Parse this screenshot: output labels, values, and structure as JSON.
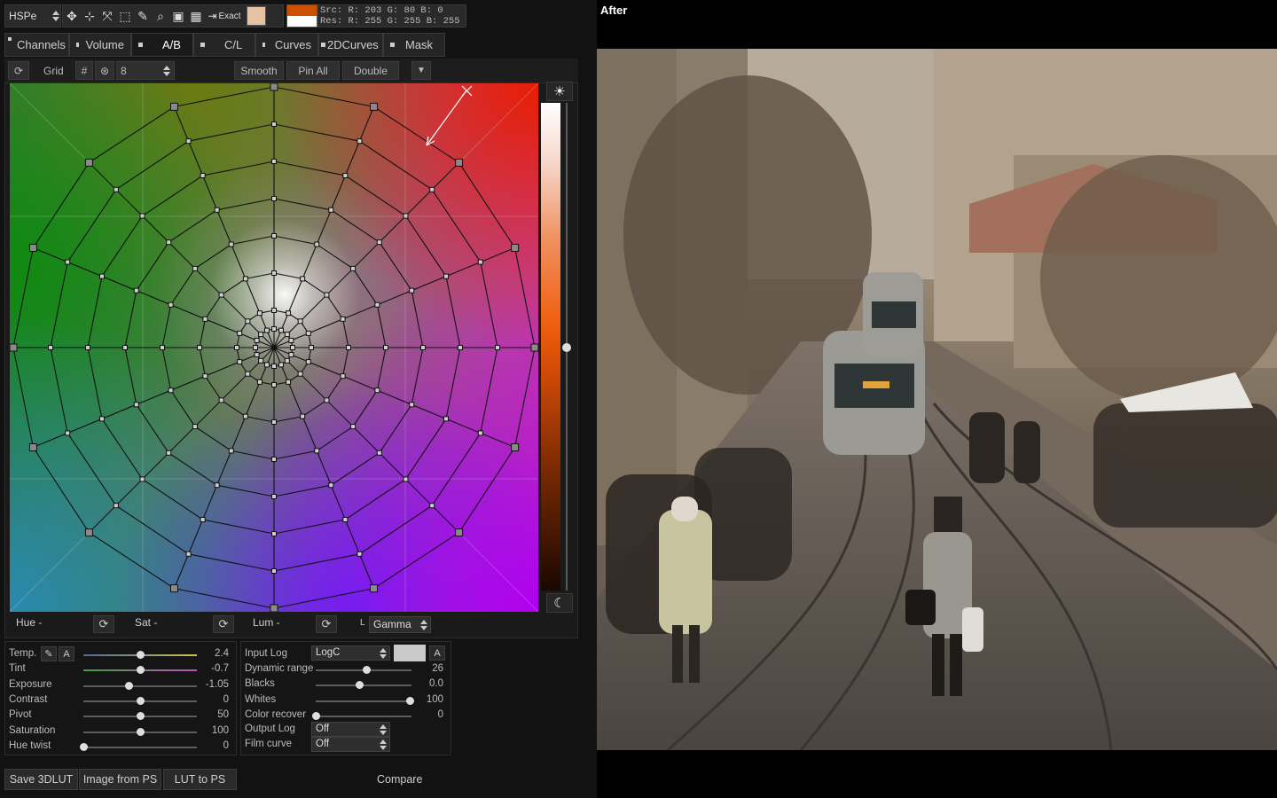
{
  "toolbar": {
    "mode_select": "HSPe",
    "exact_label": "Exact",
    "src_line": "Src: R: 203  G:  80  B:   0",
    "res_line": "Res: R: 255  G: 255  B: 255",
    "swatch_color": "#e5c2a3"
  },
  "tabs": [
    {
      "label": "Channels",
      "active": false
    },
    {
      "label": "Volume",
      "active": false
    },
    {
      "label": "A/B",
      "active": true
    },
    {
      "label": "C/L",
      "active": false
    },
    {
      "label": "Curves",
      "active": false
    },
    {
      "label": "2DCurves",
      "active": false
    },
    {
      "label": "Mask",
      "active": false
    }
  ],
  "grid_bar": {
    "grid_label": "Grid",
    "grid_value": "8",
    "smooth_label": "Smooth",
    "pin_all_label": "Pin All",
    "double_label": "Double"
  },
  "hsl_row": {
    "hue_label": "Hue -",
    "sat_label": "Sat -",
    "lum_label": "Lum -",
    "l_label": "L",
    "gamma_select": "Gamma"
  },
  "left_sliders": [
    {
      "label": "Temp.",
      "value": "2.4",
      "pos": 0.5
    },
    {
      "label": "Tint",
      "value": "-0.7",
      "pos": 0.5
    },
    {
      "label": "Exposure",
      "value": "-1.05",
      "pos": 0.4
    },
    {
      "label": "Contrast",
      "value": "0",
      "pos": 0.5
    },
    {
      "label": "Pivot",
      "value": "50",
      "pos": 0.5
    },
    {
      "label": "Saturation",
      "value": "100",
      "pos": 0.5
    },
    {
      "label": "Hue twist",
      "value": "0",
      "pos": 0.0
    }
  ],
  "right_sliders": {
    "input_log_label": "Input Log",
    "input_log_value": "LogC",
    "a_label": "A",
    "rows": [
      {
        "label": "Dynamic range",
        "value": "26",
        "pos": 0.53
      },
      {
        "label": "Blacks",
        "value": "0.0",
        "pos": 0.45
      },
      {
        "label": "Whites",
        "value": "100",
        "pos": 0.98
      },
      {
        "label": "Color recover",
        "value": "0",
        "pos": 0.0
      }
    ],
    "output_log_label": "Output Log",
    "output_log_value": "Off",
    "film_curve_label": "Film curve",
    "film_curve_value": "Off"
  },
  "bottom": {
    "save_label": "Save 3DLUT",
    "image_from_ps_label": "Image from PS",
    "lut_to_ps_label": "LUT to PS",
    "compare_label": "Compare"
  },
  "preview": {
    "title": "After"
  }
}
